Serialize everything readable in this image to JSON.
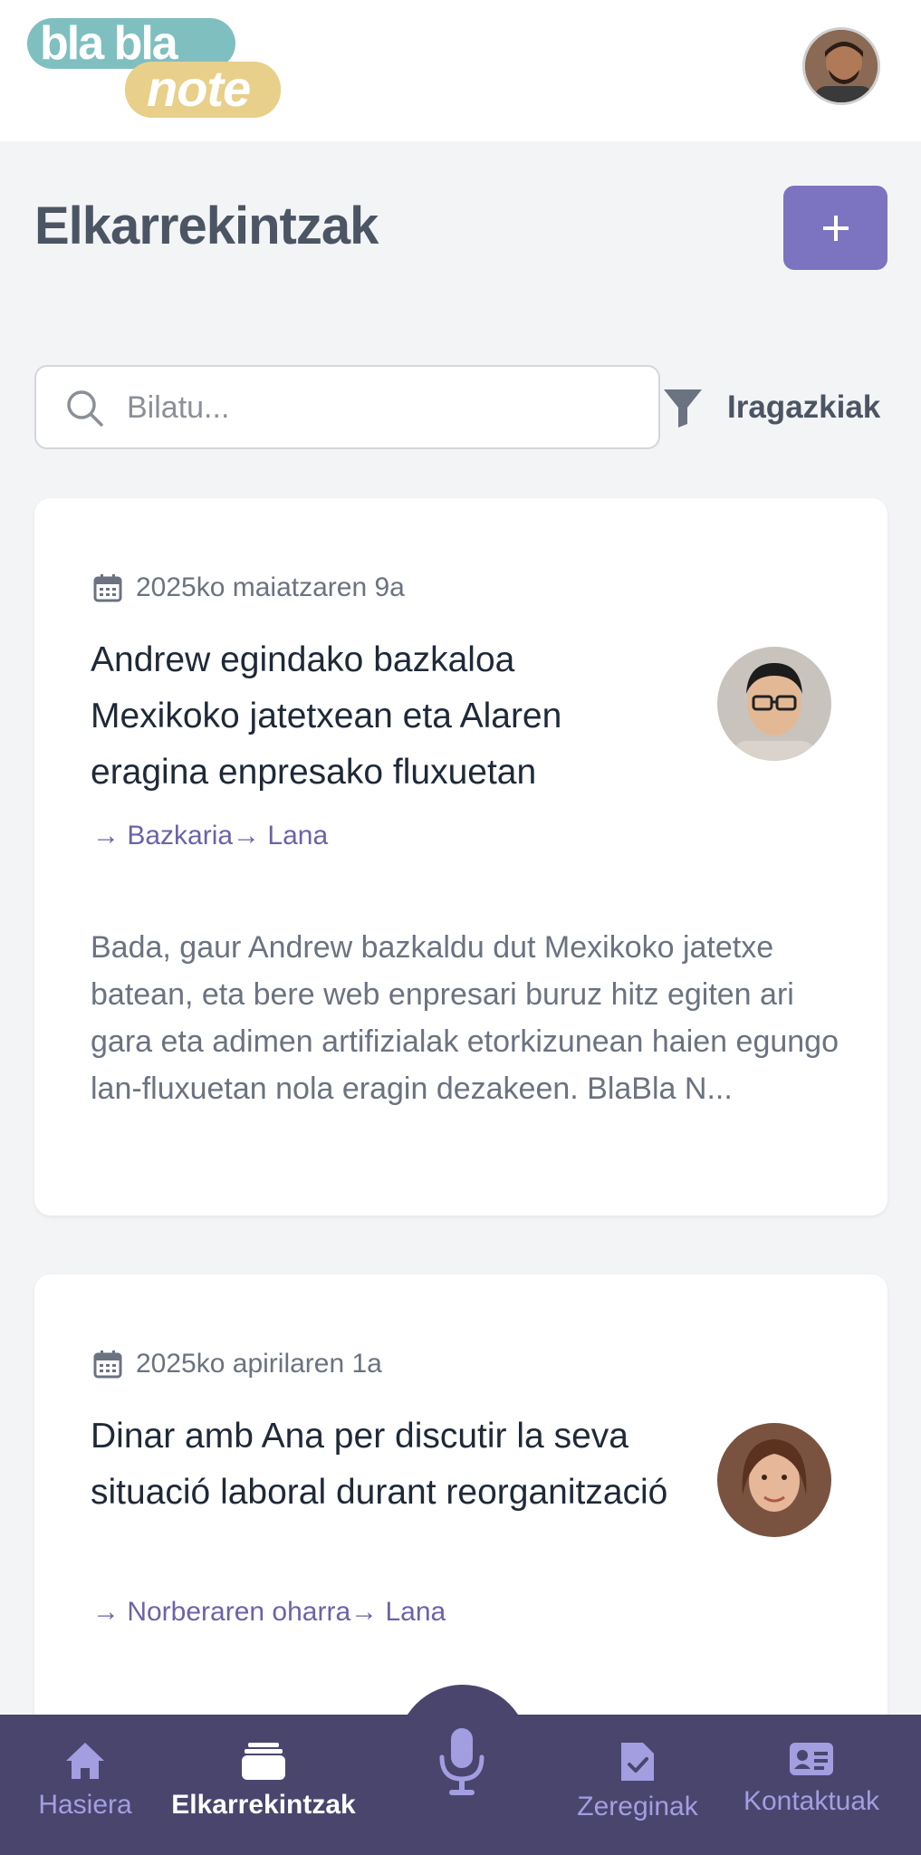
{
  "app": {
    "logo_top": "bla bla",
    "logo_bottom": "note"
  },
  "page": {
    "title": "Elkarrekintzak",
    "add_label": "+"
  },
  "search": {
    "placeholder": "Bilatu...",
    "filter_label": "Iragazkiak"
  },
  "cards": [
    {
      "date": "2025ko maiatzaren 9a",
      "title": "Andrew egindako bazkaloa Mexikoko jatetxean eta Alaren eragina enpresako fluxuetan",
      "tags": "→ Bazkaria→ Lana",
      "excerpt": "Bada, gaur Andrew bazkaldu dut Mexikoko jatetxe batean, eta bere web enpresari buruz hitz egiten ari gara eta adimen artifizialak etorkizunean haien egungo lan-fluxuetan nola eragin dezakeen. BlaBla N..."
    },
    {
      "date": "2025ko apirilaren 1a",
      "title": "Dinar amb Ana per discutir la seva situació laboral durant reorganització",
      "tags": "→ Norberaren oharra→ Lana"
    }
  ],
  "nav": {
    "home": "Hasiera",
    "conversations": "Elkarrekintzak",
    "tasks": "Zereginak",
    "contacts": "Kontaktuak"
  },
  "colors": {
    "accent": "#7c74c0",
    "nav_bg": "#4a456d",
    "tag_text": "#6b63a8"
  },
  "icons": {
    "search": "search-icon",
    "filter": "funnel-icon",
    "date": "calendar-icon",
    "home": "home-icon",
    "conversations": "inbox-icon",
    "record": "microphone-icon",
    "tasks": "task-check-icon",
    "contacts": "contact-card-icon"
  }
}
